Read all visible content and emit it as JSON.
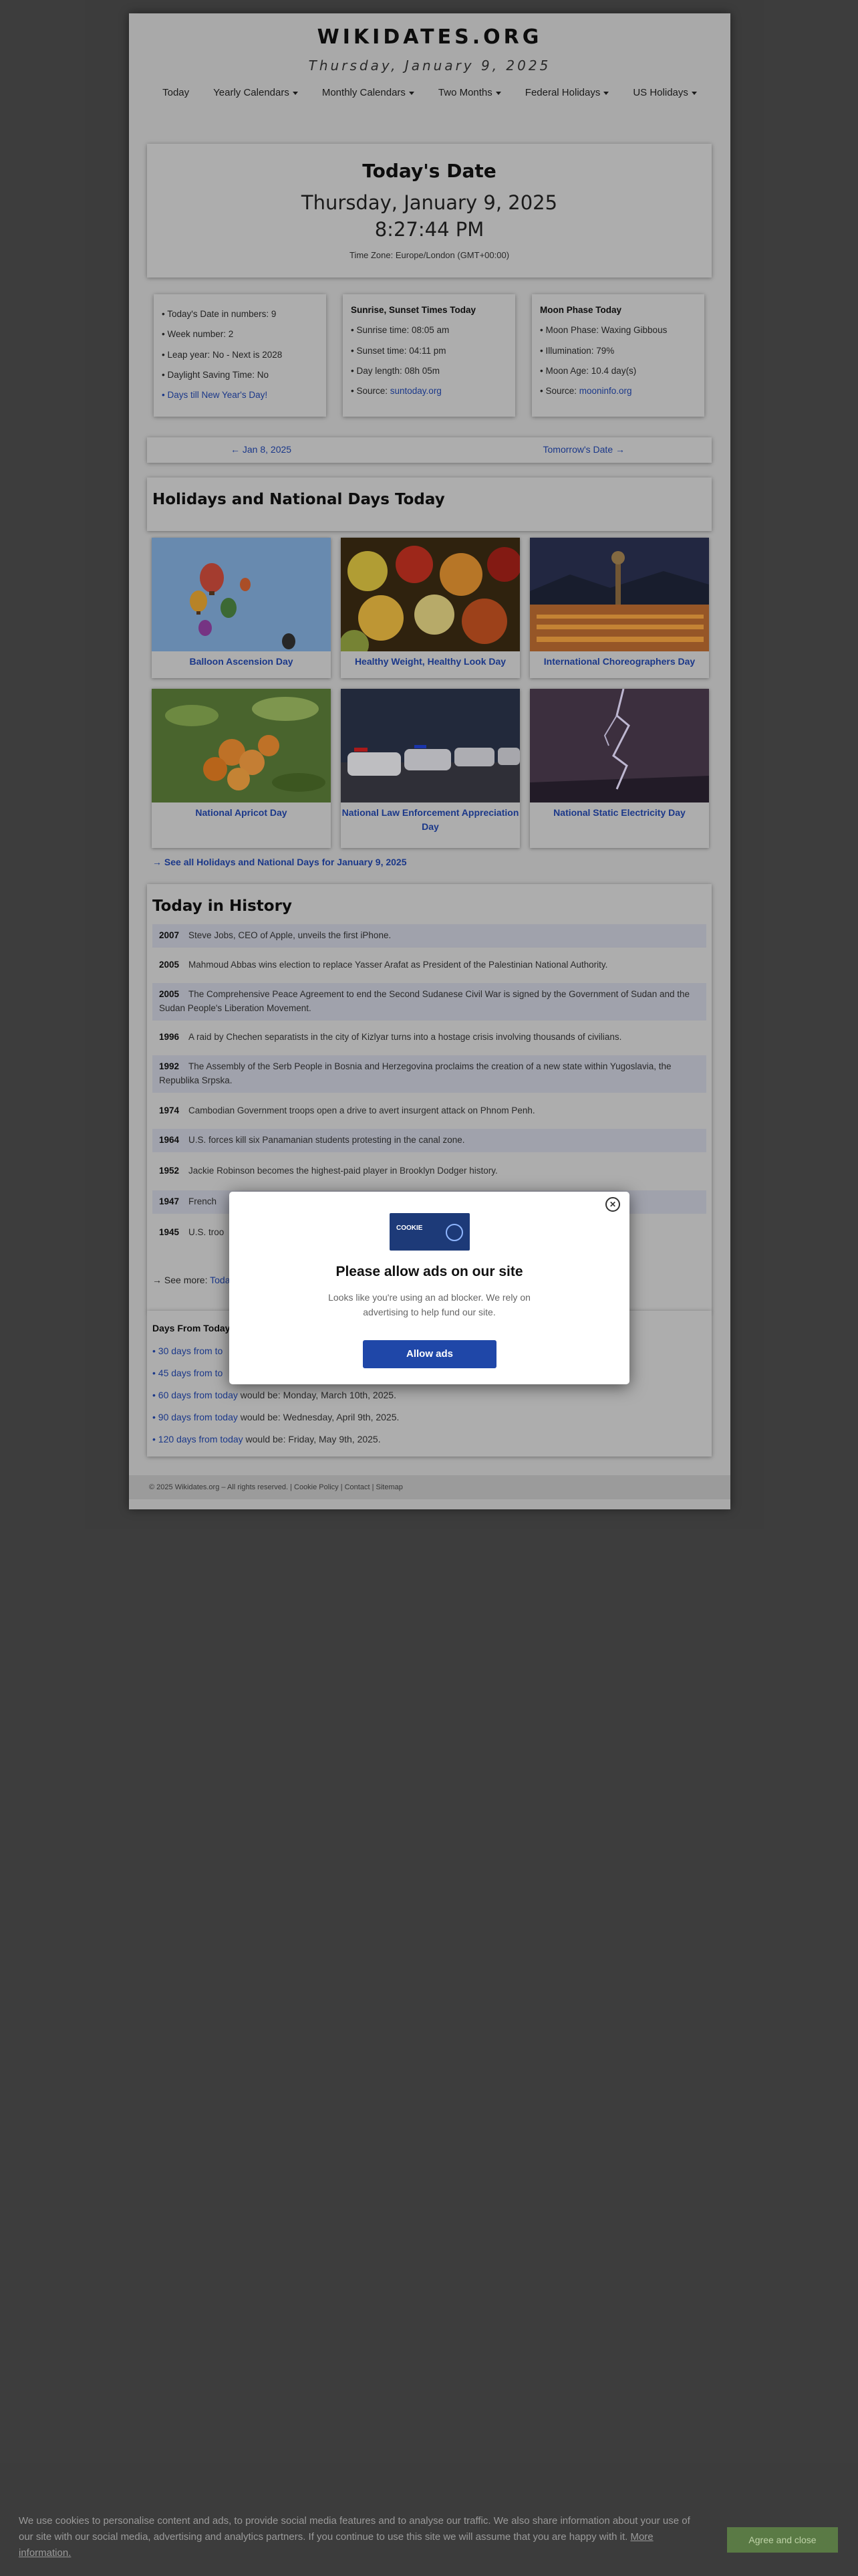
{
  "site": {
    "title": "WIKIDATES.ORG",
    "date_line": "Thursday, January 9, 2025"
  },
  "nav": [
    {
      "label": "Today",
      "dropdown": false
    },
    {
      "label": "Yearly Calendars",
      "dropdown": true
    },
    {
      "label": "Monthly Calendars",
      "dropdown": true
    },
    {
      "label": "Two Months",
      "dropdown": true
    },
    {
      "label": "Federal Holidays",
      "dropdown": true
    },
    {
      "label": "US Holidays",
      "dropdown": true
    }
  ],
  "today": {
    "heading": "Today's Date",
    "date": "Thursday, January 9, 2025",
    "time": "8:27:44 PM",
    "timezone": "Time Zone: Europe/London (GMT+00:00)"
  },
  "info_boxes": {
    "numbers": {
      "line1": "• Today's Date in numbers: 9",
      "line2": "• Week number: 2",
      "line3": "• Leap year: No - Next is 2028",
      "line4": "• Daylight Saving Time: No",
      "link": "• Days till New Year's Day!"
    },
    "sun": {
      "title": "Sunrise, Sunset Times Today",
      "line1": "• Sunrise time: 08:05 am",
      "line2": "• Sunset time: 04:11 pm",
      "line3": "• Day length: 08h 05m",
      "source_label": "• Source: ",
      "source_link": "suntoday.org"
    },
    "moon": {
      "title": "Moon Phase Today",
      "line1": "• Moon Phase: Waxing Gibbous",
      "line2": "• Illumination: 79%",
      "line3": "• Moon Age: 10.4 day(s)",
      "source_label": "• Source: ",
      "source_link": "mooninfo.org"
    }
  },
  "day_nav": {
    "prev": "← Jan 8, 2025",
    "next": "Tomorrow's Date →"
  },
  "holidays": {
    "title": "Holidays and National Days Today",
    "items": [
      {
        "label": "Balloon Ascension Day"
      },
      {
        "label": "Healthy Weight, Healthy Look Day"
      },
      {
        "label": "International Choreographers Day"
      },
      {
        "label": "National Apricot Day"
      },
      {
        "label": "National Law Enforcement Appreciation Day"
      },
      {
        "label": "National Static Electricity Day"
      }
    ],
    "see_all": "→ See all Holidays and National Days for January 9, 2025"
  },
  "history": {
    "title": "Today in History",
    "events": [
      {
        "year": "2007",
        "text": "Steve Jobs, CEO of Apple, unveils the first iPhone."
      },
      {
        "year": "2005",
        "text": "Mahmoud Abbas wins election to replace Yasser Arafat as President of the Palestinian National Authority."
      },
      {
        "year": "2005",
        "text": "The Comprehensive Peace Agreement to end the Second Sudanese Civil War is signed by the Government of Sudan and the Sudan People's Liberation Movement."
      },
      {
        "year": "1996",
        "text": "A raid by Chechen separatists in the city of Kizlyar turns into a hostage crisis involving thousands of civilians."
      },
      {
        "year": "1992",
        "text": "The Assembly of the Serb People in Bosnia and Herzegovina proclaims the creation of a new state within Yugoslavia, the Republika Srpska."
      },
      {
        "year": "1974",
        "text": "Cambodian Government troops open a drive to avert insurgent attack on Phnom Penh."
      },
      {
        "year": "1964",
        "text": "U.S. forces kill six Panamanian students protesting in the canal zone."
      },
      {
        "year": "1952",
        "text": "Jackie Robinson becomes the highest-paid player in Brooklyn Dodger history."
      },
      {
        "year": "1947",
        "text": "French"
      },
      {
        "year": "1945",
        "text": "U.S. troo"
      }
    ],
    "see_more_label": "→ See more: ",
    "see_more_link": "Toda"
  },
  "days_from_today": {
    "title": "Days From Today",
    "rows": [
      {
        "link": "• 30 days from to",
        "text": ""
      },
      {
        "link": "• 45 days from to",
        "text": ""
      },
      {
        "link": "• 60 days from today",
        "text": " would be: Monday, March 10th, 2025."
      },
      {
        "link": "• 90 days from today",
        "text": " would be: Wednesday, April 9th, 2025."
      },
      {
        "link": "• 120 days from today",
        "text": " would be: Friday, May 9th, 2025."
      }
    ]
  },
  "footer": {
    "text": "© 2025 Wikidates.org – All rights reserved. | Cookie Policy | Contact | Sitemap"
  },
  "modal": {
    "logo_text": "COOKIE",
    "title": "Please allow ads on our site",
    "body": "Looks like you're using an ad blocker. We rely on advertising to help fund our site.",
    "button": "Allow ads"
  },
  "cookie_bar": {
    "text": "We use cookies to personalise content and ads, to provide social media features and to analyse our traffic. We also share information about your use of our site with our social media, advertising and analytics partners. If you continue to use this site we will assume that you are happy with it.",
    "more_link": "More information.",
    "button": "Agree and close"
  },
  "colors": {
    "link": "#2245a8",
    "modal_button": "#1f47a8",
    "cookie_button": "#5a7a45",
    "history_alt_row": "#c4c6d2"
  }
}
